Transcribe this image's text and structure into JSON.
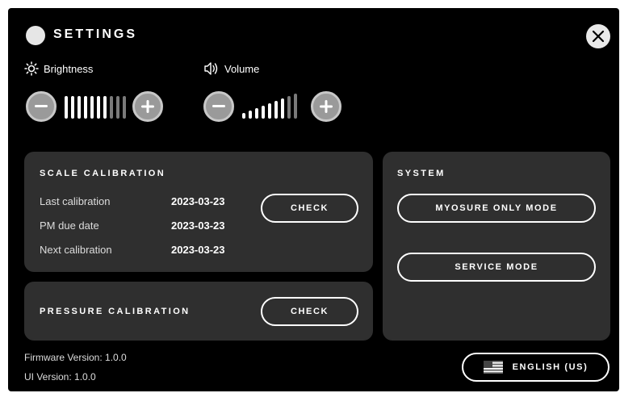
{
  "header": {
    "title": "SETTINGS"
  },
  "brightness": {
    "label": "Brightness",
    "level": 7,
    "max": 10
  },
  "volume": {
    "label": "Volume",
    "level": 7,
    "max": 9
  },
  "scale_calibration": {
    "title": "SCALE CALIBRATION",
    "rows": [
      {
        "label": "Last calibration",
        "value": "2023-03-23"
      },
      {
        "label": "PM due date",
        "value": "2023-03-23"
      },
      {
        "label": "Next calibration",
        "value": "2023-03-23"
      }
    ],
    "check_label": "CHECK"
  },
  "pressure_calibration": {
    "title": "PRESSURE CALIBRATION",
    "check_label": "CHECK"
  },
  "system": {
    "title": "SYSTEM",
    "myosure_label": "MYOSURE ONLY MODE",
    "service_label": "SERVICE MODE"
  },
  "footer": {
    "firmware": "Firmware Version: 1.0.0",
    "ui": "UI Version: 1.0.0",
    "language_label": "ENGLISH (US)"
  },
  "icons": [
    "close-icon",
    "brightness-icon",
    "volume-icon",
    "minus-icon",
    "plus-icon",
    "us-flag-icon"
  ],
  "colors": {
    "background": "#000000",
    "panel": "#2f2f2f",
    "button_gray": "#9a9a9a",
    "bar_active": "#ffffff",
    "bar_inactive": "#7a7a7a"
  }
}
